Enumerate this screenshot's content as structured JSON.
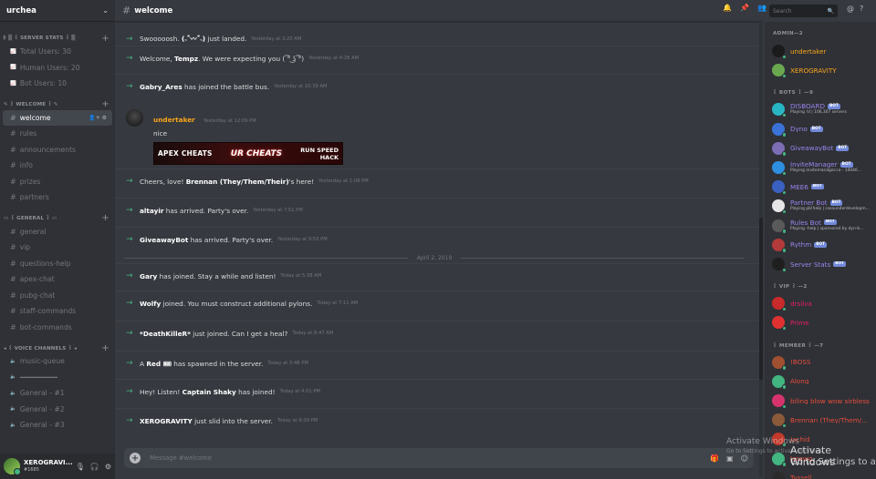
{
  "server": {
    "name": "urchea"
  },
  "channel": {
    "name": "welcome"
  },
  "sidebar": {
    "categories": [
      {
        "label": "𝄆 ▒ ꒰ SERVER STATS ꒱ ▒",
        "channels": [
          {
            "icon": "stats-icon",
            "label": "Total Users: 30"
          },
          {
            "icon": "stats-icon",
            "label": "Human Users: 20"
          },
          {
            "icon": "stats-icon",
            "label": "Bot Users: 10"
          }
        ]
      },
      {
        "label": "✎ ꒰ WELCOME ꒱ ✎",
        "channels": [
          {
            "icon": "hash-icon",
            "label": "welcome",
            "active": true
          },
          {
            "icon": "hash-icon",
            "label": "rules"
          },
          {
            "icon": "hash-icon",
            "label": "announcements"
          },
          {
            "icon": "hash-icon",
            "label": "info"
          },
          {
            "icon": "hash-icon",
            "label": "prizes"
          },
          {
            "icon": "hash-icon",
            "label": "partners"
          }
        ]
      },
      {
        "label": "▭ ꒰ GENERAL ꒱ ▭",
        "channels": [
          {
            "icon": "hash-icon",
            "label": "general"
          },
          {
            "icon": "hash-icon",
            "label": "vip"
          },
          {
            "icon": "hash-icon",
            "label": "questions-help"
          },
          {
            "icon": "hash-icon",
            "label": "apex-chat"
          },
          {
            "icon": "hash-icon",
            "label": "pubg-chat"
          },
          {
            "icon": "hash-icon",
            "label": "staff-commands"
          },
          {
            "icon": "hash-icon",
            "label": "bot-commands"
          }
        ]
      },
      {
        "label": "◂ ꒰ VOICE CHANNELS ꒱ ◂",
        "channels": [
          {
            "icon": "speaker-icon",
            "label": "music-queue"
          },
          {
            "icon": "speaker-icon",
            "label": "━━━━━━━━━"
          },
          {
            "icon": "speaker-icon",
            "label": "General - #1"
          },
          {
            "icon": "speaker-icon",
            "label": "General - #2"
          },
          {
            "icon": "speaker-icon",
            "label": "General - #3"
          }
        ]
      }
    ]
  },
  "user": {
    "name": "XEROGRAVI...",
    "discriminator": "#1685"
  },
  "messages": [
    {
      "parts": [
        "Swooooosh. ",
        "(˵¯͒〰¯͒˵)",
        " just landed."
      ],
      "ts": "Yesterday at 3:20 AM"
    },
    {
      "parts": [
        "Welcome, ",
        "Tempz",
        ". We were expecting you ( ͡° ͜ʖ ͡°)"
      ],
      "ts": "Yesterday at 4:28 AM"
    },
    {
      "parts": [
        "",
        "Gabry_Ares",
        " has joined the battle bus."
      ],
      "ts": "Yesterday at 10:39 AM"
    },
    {
      "parts": [
        "Cheers, love! ",
        "Brennan (They/Them/Their)",
        "'s here!"
      ],
      "ts": "Yesterday at 1:08 PM"
    },
    {
      "parts": [
        "",
        "altayir",
        " has arrived. Party's over."
      ],
      "ts": "Yesterday at 7:51 PM"
    },
    {
      "parts": [
        "",
        "GiveawayBot",
        " has arrived. Party's over."
      ],
      "ts": "Yesterday at 9:53 PM"
    },
    {
      "parts": [
        "",
        "Gary",
        " has joined. Stay a while and listen!"
      ],
      "ts": "Today at 5:38 AM"
    },
    {
      "parts": [
        "",
        "Wolfy",
        " joined. You must construct additional pylons."
      ],
      "ts": "Today at 7:11 AM"
    },
    {
      "parts": [
        "",
        "*DeathKilleR*",
        " just joined. Can I get a heal?"
      ],
      "ts": "Today at 8:47 AM"
    },
    {
      "parts": [
        "A ",
        "Red 🎟",
        " has spawned in the server."
      ],
      "ts": "Today at 3:48 PM"
    },
    {
      "parts": [
        "Hey! Listen! ",
        "Captain Shaky",
        " has joined!"
      ],
      "ts": "Today at 4:01 PM"
    },
    {
      "parts": [
        "",
        "XEROGRAVITY",
        " just slid into the server."
      ],
      "ts": "Today at 6:09 PM"
    }
  ],
  "post": {
    "author": "undertaker",
    "author_color": "#faa61a",
    "ts": "Yesterday at 12:09 PM",
    "text": "nice",
    "banner": {
      "left": "APEX CHEATS",
      "center": "UR CHEATS",
      "right1": "RUN SPEED",
      "right2": "HACK"
    }
  },
  "date_divider": "April 2, 2019",
  "composer": {
    "placeholder": "Message #welcome"
  },
  "search": {
    "placeholder": "Search"
  },
  "members": {
    "groups": [
      {
        "label": "ADMIN—2",
        "items": [
          {
            "name": "undertaker",
            "color": "#faa61a",
            "status": "#43b581",
            "avatar": "#1b1b1b"
          },
          {
            "name": "XEROGRAVITY",
            "color": "#faa61a",
            "status": "#43b581",
            "avatar": "#6aa84f"
          }
        ]
      },
      {
        "label": "꒰ BOTS ꒱ —9",
        "items": [
          {
            "name": "DISBOARD",
            "color": "#9b84ee",
            "bot": "BOT",
            "activity": "Playing !d | 106,307 servers",
            "status": "#43b581",
            "avatar": "#29b6c4"
          },
          {
            "name": "Dyno",
            "color": "#9b84ee",
            "bot": "BOT",
            "status": "#43b581",
            "avatar": "#3a72d8"
          },
          {
            "name": "GiveawayBot",
            "color": "#9b84ee",
            "bot": "BOT",
            "status": "#43b581",
            "avatar": "#7c6db5"
          },
          {
            "name": "InviteManager",
            "color": "#9b84ee",
            "bot": "BOT",
            "activity": "Playing invitemanager.co - 10046...",
            "status": "#43b581",
            "avatar": "#2e8ee0"
          },
          {
            "name": "MEE6",
            "color": "#9b84ee",
            "bot": "BOT",
            "status": "#43b581",
            "avatar": "#3a60c0"
          },
          {
            "name": "Partner Bot",
            "color": "#9b84ee",
            "bot": "BOT",
            "activity": "Playing pb!help | cassunderdevelopm...",
            "status": "#43b581",
            "avatar": "#e6e6e6"
          },
          {
            "name": "Rules Bot",
            "color": "#9b84ee",
            "bot": "BOT",
            "activity": "Playing -help | sponsored by dyn-b...",
            "status": "#43b581",
            "avatar": "#5a5a5a"
          },
          {
            "name": "Rythm",
            "color": "#9b84ee",
            "bot": "BOT",
            "status": "#43b581",
            "avatar": "#b23a3a"
          },
          {
            "name": "Server Stats",
            "color": "#9b84ee",
            "bot": "BOT",
            "status": "#43b581",
            "avatar": "#1f1f1f"
          }
        ]
      },
      {
        "label": "꒰ VIP ꒱ —2",
        "items": [
          {
            "name": "drsilva",
            "color": "#e91e63",
            "status": "#43b581",
            "avatar": "#c92a2a"
          },
          {
            "name": "Prime",
            "color": "#e91e63",
            "status": "#43b581",
            "avatar": "#e03131"
          }
        ]
      },
      {
        "label": "꒰ MEMBER ꒱ —7",
        "items": [
          {
            "name": "!BOSS",
            "color": "#e74c3c",
            "status": "#43b581",
            "avatar": "#a05030"
          },
          {
            "name": "Along____",
            "color": "#e74c3c",
            "status": "#43b581",
            "avatar": "#43b581"
          },
          {
            "name": "biling blow wow sirbless",
            "color": "#e74c3c",
            "status": "#43b581",
            "avatar": "#d6336c"
          },
          {
            "name": "Brennan (They/Them/...",
            "color": "#e74c3c",
            "status": "#43b581",
            "avatar": "#8a5a3a"
          },
          {
            "name": "Jachid",
            "color": "#e74c3c",
            "status": "#43b581",
            "avatar": "#c0392b"
          },
          {
            "name": "Jorawg",
            "color": "#e74c3c",
            "status": "#43b581",
            "avatar": "#43b581"
          },
          {
            "name": "Tyssell",
            "color": "#e74c3c",
            "status": "#43b581",
            "avatar": "#2b2b2b"
          }
        ]
      }
    ]
  },
  "watermark": {
    "line1": "Activate Windows",
    "line2": "Go to Settings to activate Windows.",
    "line3": "Activate Windows",
    "line4": "Go to Settings to activa"
  }
}
